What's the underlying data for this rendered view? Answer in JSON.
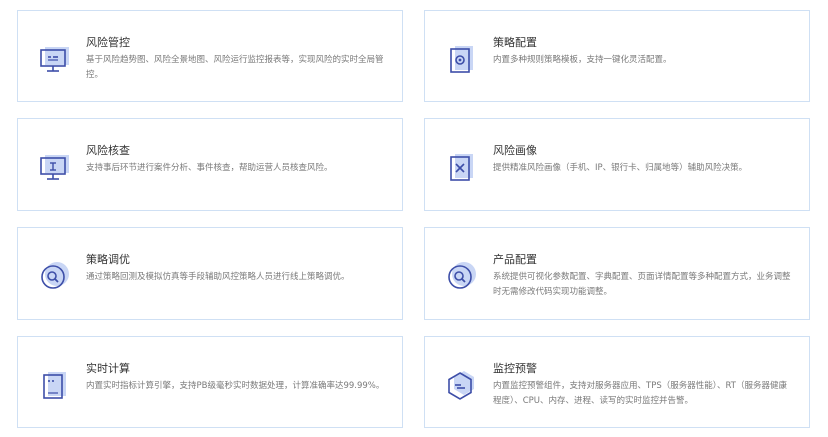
{
  "cards": [
    {
      "title": "风险管控",
      "desc": "基于风险趋势图、风险全景地图、风险运行监控报表等，实现风险的实时全局管控。",
      "icon": "monitor-icon"
    },
    {
      "title": "策略配置",
      "desc": "内置多种规则策略模板，支持一键化灵活配置。",
      "icon": "phone-settings-icon"
    },
    {
      "title": "风险核查",
      "desc": "支持事后环节进行案件分析、事件核查，帮助运营人员核查风险。",
      "icon": "monitor-check-icon"
    },
    {
      "title": "风险画像",
      "desc": "提供精准风险画像（手机、IP、银行卡、归属地等）辅助风险决策。",
      "icon": "document-x-icon"
    },
    {
      "title": "策略调优",
      "desc": "通过策略回测及模拟仿真等手段辅助风控策略人员进行线上策略调优。",
      "icon": "search-icon"
    },
    {
      "title": "产品配置",
      "desc": "系统提供可视化参数配置、字典配置、页面详情配置等多种配置方式，业务调整时无需修改代码实现功能调整。",
      "icon": "search-icon"
    },
    {
      "title": "实时计算",
      "desc": "内置实时指标计算引擎，支持PB级毫秒实时数据处理，计算准确率达99.99%。",
      "icon": "document-icon"
    },
    {
      "title": "监控预警",
      "desc": "内置监控预警组件，支持对服务器应用、TPS（服务器性能）、RT（服务器健康程度）、CPU、内存、进程、读写的实时监控并告警。",
      "icon": "hexagon-alert-icon"
    }
  ],
  "colors": {
    "accent": "#3d4ea8",
    "shadow": "#c9d6f5",
    "border": "#cfe0f4"
  }
}
